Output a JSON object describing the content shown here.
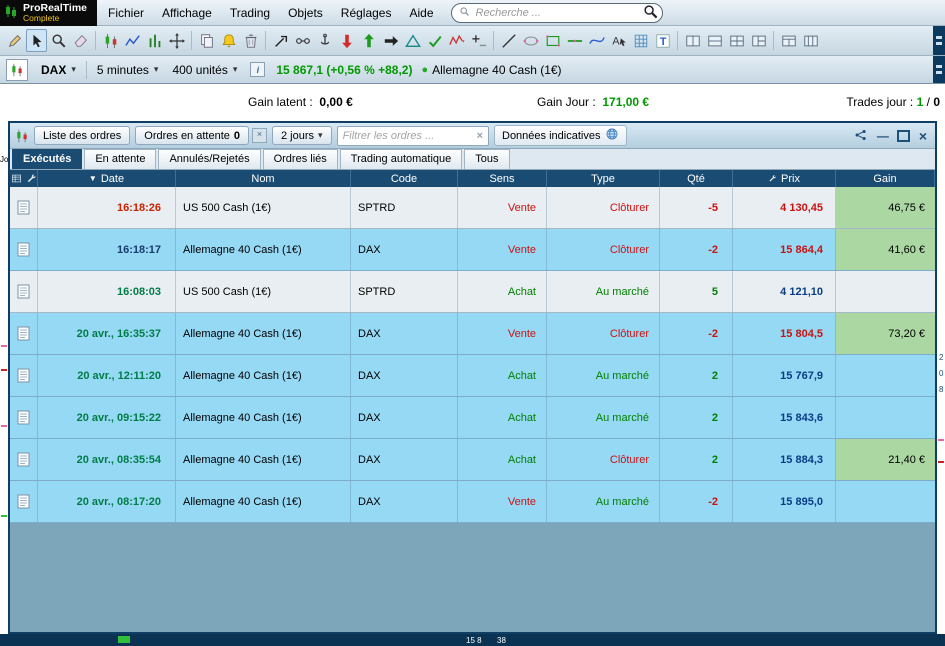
{
  "app": {
    "logo": {
      "title": "ProRealTime",
      "subtitle": "Complete"
    },
    "menus": [
      "Fichier",
      "Affichage",
      "Trading",
      "Objets",
      "Réglages",
      "Aide"
    ],
    "search": {
      "placeholder": "Recherche ..."
    },
    "toolbar": {
      "selected": "cursor-icon",
      "icons": [
        "pencil-icon",
        "cursor-icon",
        "zoom-icon",
        "eraser-icon",
        "|",
        "candles-icon",
        "line-chart-icon",
        "bar-chart-icon",
        "move-icon",
        "|",
        "copy-icon",
        "alert-bell-icon",
        "trash-icon",
        "|",
        "trend-arrow-icon",
        "link-icon",
        "anchor-icon",
        "sell-arrow-icon",
        "buy-arrow-icon",
        "order-arrow-icon",
        "triangle-icon",
        "check-icon",
        "zigzag-icon",
        "plus-line-icon",
        "|",
        "diagonal-line-icon",
        "ellipse-icon",
        "rectangle-icon",
        "hline-icon",
        "curve-icon",
        "text-cursor-icon",
        "grid-icon",
        "text-tool-icon",
        "|",
        "layout-split-v-icon",
        "layout-split-h-icon",
        "layout-grid-icon",
        "layout-mixed-icon",
        "|",
        "layout-wide-icon",
        "layout-tall-icon"
      ]
    },
    "instrument": {
      "symbol": "DAX",
      "timeframe": "5 minutes",
      "units": "400 unités",
      "price": "15 867,1",
      "change": "(+0,56 % +88,2)",
      "name": "Allemagne 40 Cash (1€)"
    },
    "status": {
      "gain_latent_label": "Gain latent :",
      "gain_latent_value": "0,00 €",
      "gain_jour_label": "Gain Jour :",
      "gain_jour_value": "171,00 €",
      "trades_label": "Trades jour :",
      "trades_win": "1",
      "trades_sep": "/",
      "trades_loss": "0"
    },
    "edges": {
      "left_text": "Jo",
      "right_scale": [
        "2",
        "0",
        "8"
      ],
      "bottom_texts": [
        "15 8",
        "38"
      ]
    }
  },
  "window": {
    "titlebar": {
      "orders_list_btn": "Liste des ordres",
      "pending_btn": "Ordres en attente",
      "pending_count": "0",
      "period_btn": "2 jours",
      "filter_placeholder": "Filtrer les ordres ...",
      "indicative_label": "Données indicatives"
    },
    "tabs": [
      {
        "label": "Exécutés",
        "active": true
      },
      {
        "label": "En attente",
        "active": false
      },
      {
        "label": "Annulés/Rejetés",
        "active": false
      },
      {
        "label": "Ordres liés",
        "active": false
      },
      {
        "label": "Trading automatique",
        "active": false
      },
      {
        "label": "Tous",
        "active": false
      }
    ],
    "table": {
      "headers": {
        "date": "Date",
        "nom": "Nom",
        "code": "Code",
        "sens": "Sens",
        "type": "Type",
        "qte": "Qté",
        "prix": "Prix",
        "gain": "Gain"
      },
      "rows": [
        {
          "date": "16:18:26",
          "nom": "US 500 Cash (1€)",
          "code": "SPTRD",
          "sens": "Vente",
          "type": "Clôturer",
          "qte": "-5",
          "prix": "4 130,45",
          "gain": "46,75 €",
          "bg": "gray",
          "date_color": "red",
          "prix_color": "red"
        },
        {
          "date": "16:18:17",
          "nom": "Allemagne 40 Cash (1€)",
          "code": "DAX",
          "sens": "Vente",
          "type": "Clôturer",
          "qte": "-2",
          "prix": "15 864,4",
          "gain": "41,60 €",
          "bg": "blue",
          "date_color": "navy",
          "prix_color": "red"
        },
        {
          "date": "16:08:03",
          "nom": "US 500 Cash (1€)",
          "code": "SPTRD",
          "sens": "Achat",
          "type": "Au marché",
          "qte": "5",
          "prix": "4 121,10",
          "gain": "",
          "bg": "gray",
          "date_color": "green",
          "prix_color": "navy"
        },
        {
          "date": "20 avr., 16:35:37",
          "nom": "Allemagne 40 Cash (1€)",
          "code": "DAX",
          "sens": "Vente",
          "type": "Clôturer",
          "qte": "-2",
          "prix": "15 804,5",
          "gain": "73,20 €",
          "bg": "blue",
          "date_color": "green",
          "prix_color": "red"
        },
        {
          "date": "20 avr., 12:11:20",
          "nom": "Allemagne 40 Cash (1€)",
          "code": "DAX",
          "sens": "Achat",
          "type": "Au marché",
          "qte": "2",
          "prix": "15 767,9",
          "gain": "",
          "bg": "blue",
          "date_color": "green",
          "prix_color": "navy"
        },
        {
          "date": "20 avr., 09:15:22",
          "nom": "Allemagne 40 Cash (1€)",
          "code": "DAX",
          "sens": "Achat",
          "type": "Au marché",
          "qte": "2",
          "prix": "15 843,6",
          "gain": "",
          "bg": "blue",
          "date_color": "green",
          "prix_color": "navy"
        },
        {
          "date": "20 avr., 08:35:54",
          "nom": "Allemagne 40 Cash (1€)",
          "code": "DAX",
          "sens": "Achat",
          "type": "Clôturer",
          "qte": "2",
          "prix": "15 884,3",
          "gain": "21,40 €",
          "bg": "blue",
          "date_color": "green",
          "prix_color": "navy"
        },
        {
          "date": "20 avr., 08:17:20",
          "nom": "Allemagne 40 Cash (1€)",
          "code": "DAX",
          "sens": "Vente",
          "type": "Au marché",
          "qte": "-2",
          "prix": "15 895,0",
          "gain": "",
          "bg": "blue",
          "date_color": "green",
          "prix_color": "navy"
        }
      ]
    }
  },
  "colors": {
    "buy_green": "#008000",
    "sell_red": "#cc1111",
    "gain_green_bg": "#abd8a2",
    "row_blue": "#96d9f5",
    "row_gray": "#e8eef2",
    "header_navy": "#1a4b72",
    "price_up_green": "#009900"
  }
}
